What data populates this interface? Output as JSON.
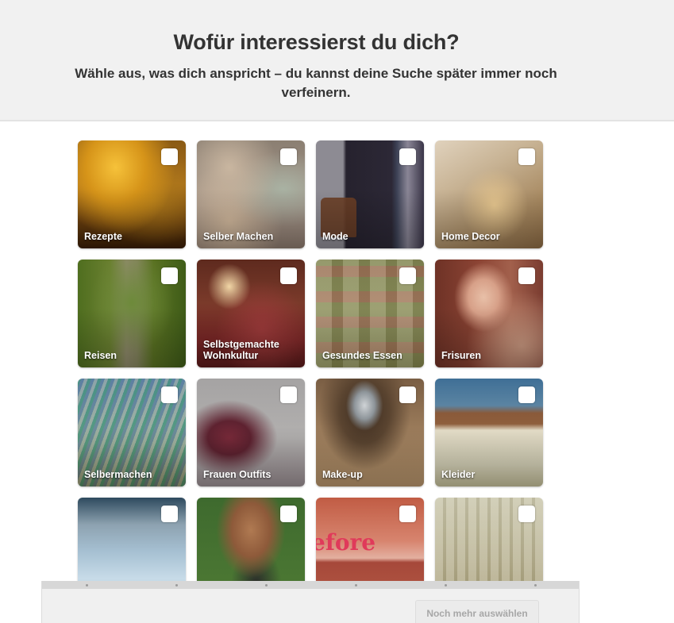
{
  "header": {
    "title": "Wofür interessierst du dich?",
    "subtitle": "Wähle aus, was dich anspricht – du kannst deine Suche später immer noch verfeinern."
  },
  "topics": [
    {
      "label": "Rezepte",
      "checked": false
    },
    {
      "label": "Selber Machen",
      "checked": false
    },
    {
      "label": "Mode",
      "checked": false
    },
    {
      "label": "Home Decor",
      "checked": false
    },
    {
      "label": "Reisen",
      "checked": false
    },
    {
      "label": "Selbstgemachte Wohnkultur",
      "checked": false
    },
    {
      "label": "Gesundes Essen",
      "checked": false
    },
    {
      "label": "Frisuren",
      "checked": false
    },
    {
      "label": "Selbermachen",
      "checked": false
    },
    {
      "label": "Frauen Outfits",
      "checked": false
    },
    {
      "label": "Make-up",
      "checked": false
    },
    {
      "label": "Kleider",
      "checked": false
    },
    {
      "label": "",
      "checked": false
    },
    {
      "label": "",
      "checked": false
    },
    {
      "label": "",
      "checked": false,
      "image_text": "efore"
    },
    {
      "label": "",
      "checked": false
    }
  ],
  "footer": {
    "progress_steps": 6,
    "progress_completed": 0,
    "more_button_label": "Noch mehr auswählen"
  }
}
